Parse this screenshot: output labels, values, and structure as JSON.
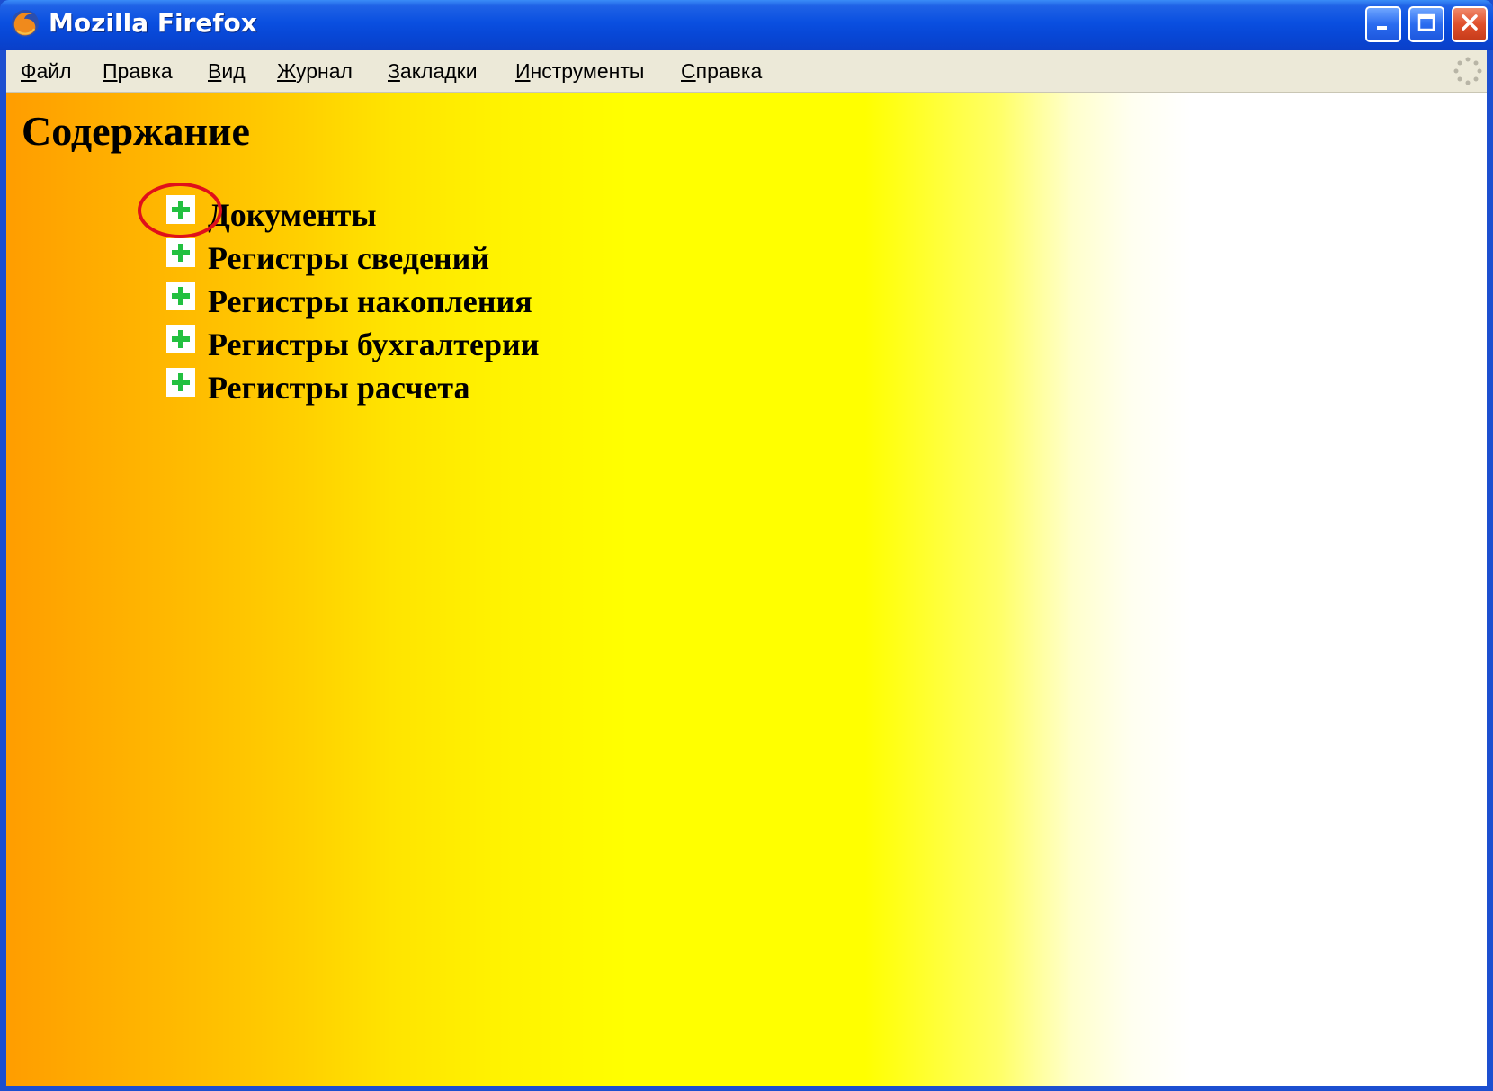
{
  "window": {
    "title": "Mozilla Firefox",
    "app_icon": "firefox-icon",
    "controls": [
      "minimize-icon",
      "maximize-icon",
      "close-icon"
    ],
    "title_color": "#ffffff",
    "titlebar_color": "#0a4fe0"
  },
  "menubar": {
    "items": [
      {
        "label": "Файл",
        "accel": "Ф",
        "rest": "айл"
      },
      {
        "label": "Правка",
        "accel": "П",
        "rest": "равка"
      },
      {
        "label": "Вид",
        "accel": "В",
        "rest": "ид"
      },
      {
        "label": "Журнал",
        "accel": "Ж",
        "rest": "урнал"
      },
      {
        "label": "Закладки",
        "accel": "З",
        "rest": "акладки"
      },
      {
        "label": "Инструменты",
        "accel": "И",
        "rest": "нструменты"
      },
      {
        "label": "Справка",
        "accel": "С",
        "rest": "правка"
      }
    ],
    "throbber_icon": "loading-throbber-icon"
  },
  "page": {
    "title": "Содержание",
    "tree": [
      {
        "label": "Документы",
        "icon": "plus-expand-icon",
        "highlighted": true
      },
      {
        "label": "Регистры сведений",
        "icon": "plus-expand-icon",
        "highlighted": false
      },
      {
        "label": "Регистры накопления",
        "icon": "plus-expand-icon",
        "highlighted": false
      },
      {
        "label": "Регистры бухгалтерии",
        "icon": "plus-expand-icon",
        "highlighted": false
      },
      {
        "label": "Регистры расчета",
        "icon": "plus-expand-icon",
        "highlighted": false
      }
    ]
  },
  "colors": {
    "gradient_left": "#ff9d00",
    "gradient_mid": "#ffff00",
    "gradient_right": "#ffffff",
    "expand_plus": "#22c040",
    "highlight": "#e0101a"
  }
}
